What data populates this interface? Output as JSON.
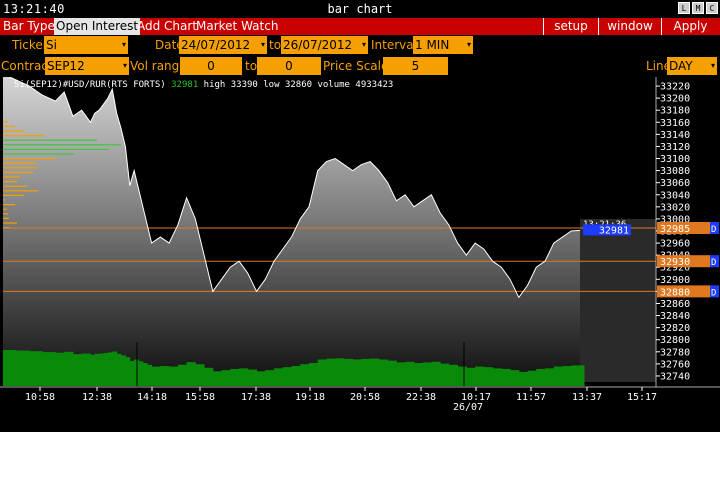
{
  "window": {
    "clock": "13:21:40",
    "title": "bar chart",
    "buttons": [
      "L",
      "M",
      "C"
    ]
  },
  "menu": {
    "items": [
      "Bar Type",
      "Open Interest",
      "Add Chart",
      "Market Watch"
    ],
    "right": [
      "setup",
      "window",
      "Apply"
    ]
  },
  "controls": {
    "ticker_label": "Ticker",
    "ticker": "Si",
    "date_label": "Date",
    "date_from": "24/07/2012",
    "date_to_label": "to",
    "date_to": "26/07/2012",
    "interval_label": "Interval",
    "interval": "1 MIN",
    "contract_label": "Contract",
    "contract": "SEP12",
    "volrange_label": "Vol range",
    "vol_from": "0",
    "vol_to_label": "to",
    "vol_to": "0",
    "pricescale_label": "Price Scale",
    "pricescale": "5",
    "line_label": "Line",
    "line": "DAY"
  },
  "legend": {
    "symbol": "Si(SEP12)#USD/RUR(RTS FORTS)",
    "last": "32981",
    "high": "high 33390",
    "low": "low 32860",
    "volume": "volume 4933423"
  },
  "colors": {
    "accent": "#f5a000",
    "menu": "#c80000",
    "volume": "#0a8a0a",
    "hline": "#e07820",
    "lastprice": "#1e3cff"
  },
  "chart_data": {
    "type": "line",
    "y_ticks": [
      33220,
      33200,
      33180,
      33160,
      33140,
      33120,
      33100,
      33080,
      33060,
      33040,
      33020,
      33000,
      32980,
      32960,
      32940,
      32920,
      32900,
      32880,
      32860,
      32840,
      32820,
      32800,
      32780,
      32760,
      32740
    ],
    "ylim": [
      32730,
      33230
    ],
    "x_tick_labels": [
      "10:58",
      "12:38",
      "14:18",
      "15:58",
      "17:38",
      "19:18",
      "20:58",
      "22:38",
      "10:17",
      "11:57",
      "13:37",
      "15:17"
    ],
    "date_label": "26/07",
    "x": [
      0,
      3,
      6,
      9,
      12,
      14,
      16,
      18,
      20,
      21,
      22,
      23,
      24,
      25,
      26,
      27,
      28,
      29,
      30,
      31,
      32,
      33,
      34,
      36,
      38,
      40,
      42,
      44,
      46,
      48,
      50,
      52,
      54,
      56,
      58,
      60,
      62,
      64,
      66,
      68,
      70,
      72,
      74,
      76,
      78,
      80,
      82,
      84,
      86,
      88,
      90,
      92,
      94,
      96,
      98,
      100,
      102,
      104,
      106,
      108,
      110,
      112,
      114,
      116,
      118,
      120,
      122,
      124,
      126,
      128,
      130,
      132
    ],
    "y": [
      33240,
      33230,
      33220,
      33205,
      33195,
      33210,
      33170,
      33180,
      33160,
      33175,
      33180,
      33190,
      33200,
      33215,
      33175,
      33150,
      33120,
      33055,
      33080,
      33050,
      33020,
      32990,
      32960,
      32970,
      32960,
      32990,
      33035,
      33000,
      32940,
      32880,
      32900,
      32920,
      32930,
      32910,
      32880,
      32900,
      32930,
      32950,
      32970,
      33000,
      33020,
      33080,
      33095,
      33100,
      33090,
      33080,
      33090,
      33095,
      33080,
      33060,
      33030,
      33040,
      33020,
      33030,
      33040,
      33010,
      32990,
      32960,
      32940,
      32960,
      32950,
      32930,
      32920,
      32900,
      32870,
      32890,
      32920,
      32930,
      32960,
      32970,
      32980,
      32981
    ],
    "time_labels_right": "13:21:36",
    "price_markers": [
      {
        "value": "32985",
        "price": 32985,
        "type": "D"
      },
      {
        "value": "32930",
        "price": 32930,
        "type": "D"
      },
      {
        "value": "32880",
        "price": 32880,
        "type": "D"
      }
    ],
    "last_price_label": "32981",
    "volume_profile": [
      0.06,
      0.12,
      0.05,
      0.04,
      0.03,
      0.1,
      0.02,
      0.18,
      0.3,
      0.2,
      0.12,
      0.14,
      0.25,
      0.3,
      0.28,
      0.45,
      0.6,
      0.9,
      1.0,
      0.8,
      0.35,
      0.18,
      0.1,
      0.04
    ]
  }
}
